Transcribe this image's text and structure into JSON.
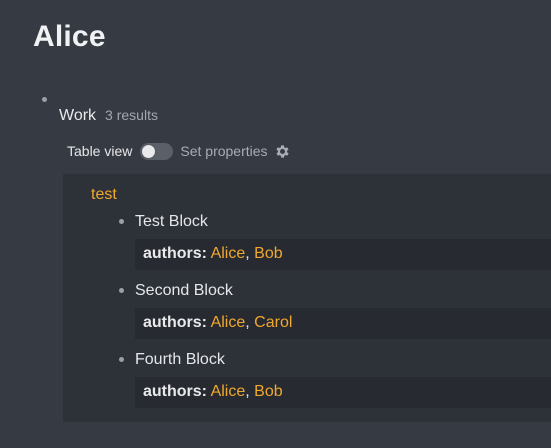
{
  "page": {
    "title": "Alice"
  },
  "query": {
    "name": "Work",
    "count_label": "3 results",
    "controls": {
      "table_view_label": "Table view",
      "table_view_on": false,
      "set_properties_label": "Set properties"
    }
  },
  "results": {
    "group_label": "test",
    "blocks": [
      {
        "title": "Test Block",
        "prop_key": "authors:",
        "values": [
          "Alice",
          "Bob"
        ]
      },
      {
        "title": "Second Block",
        "prop_key": "authors:",
        "values": [
          "Alice",
          "Carol"
        ]
      },
      {
        "title": "Fourth Block",
        "prop_key": "authors:",
        "values": [
          "Alice",
          "Bob"
        ]
      }
    ]
  },
  "colors": {
    "background": "#363a42",
    "panel": "#2d3138",
    "props_box": "#272a30",
    "link": "#f0a830"
  },
  "icons": {
    "settings": "gear-icon"
  }
}
